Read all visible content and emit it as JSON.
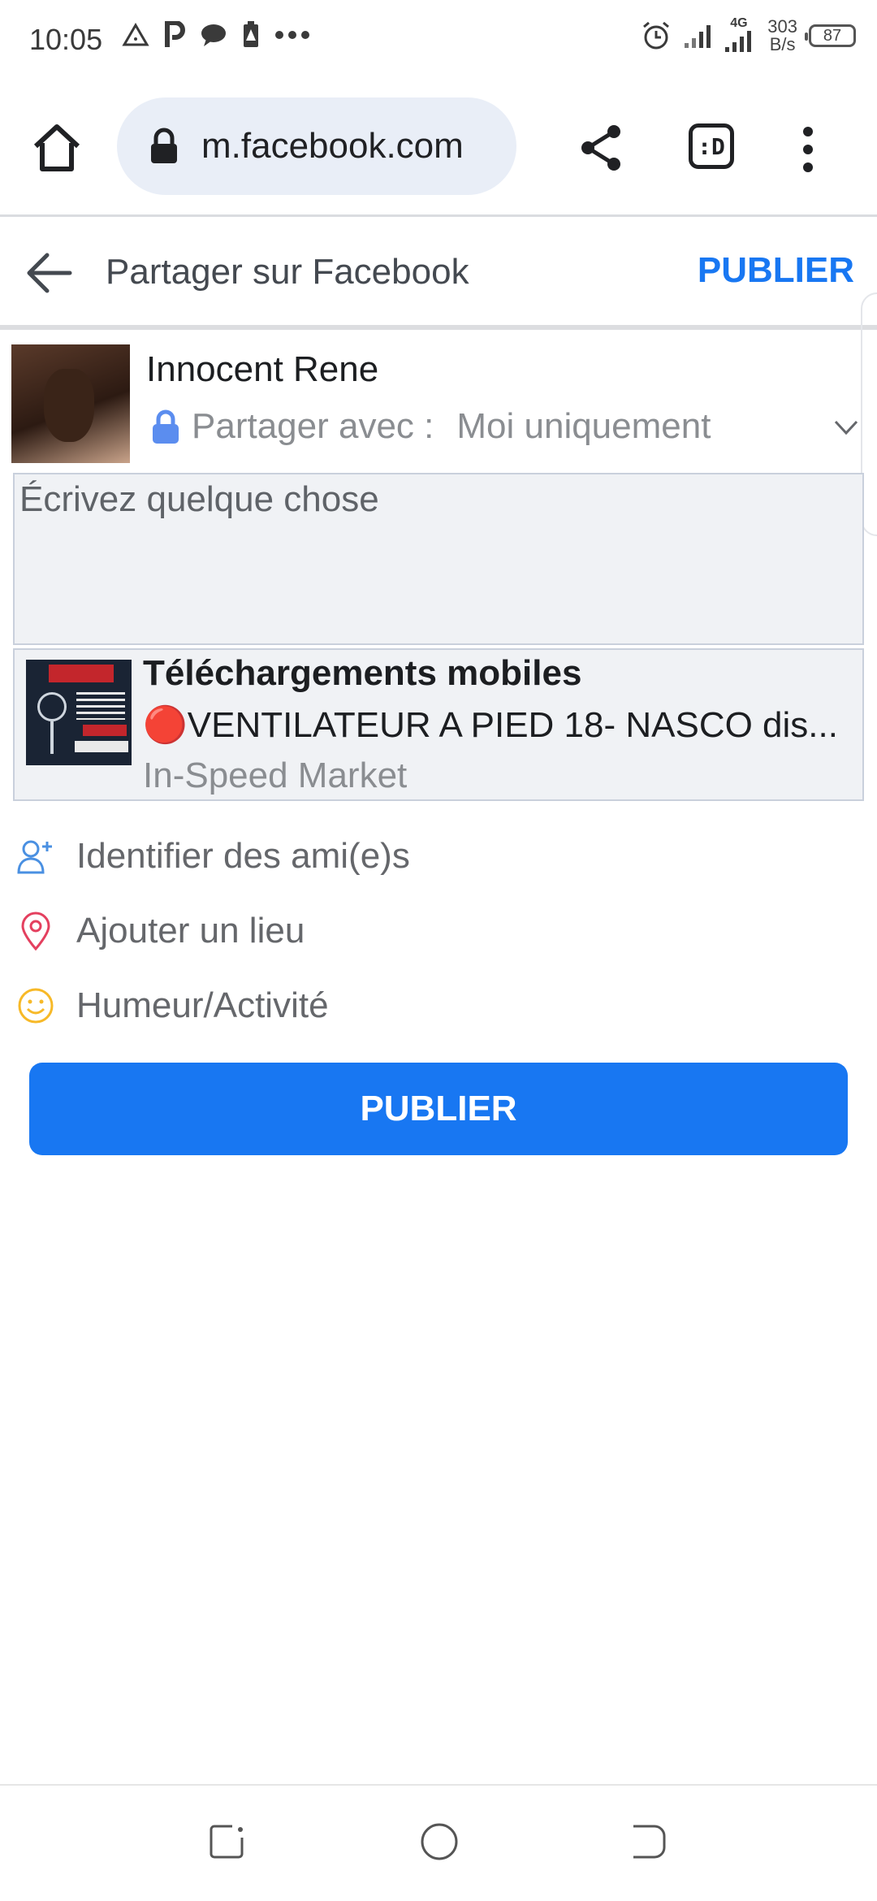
{
  "status_bar": {
    "time": "10:05",
    "network": "4G",
    "speed_value": "303",
    "speed_unit": "B/s",
    "battery": "87",
    "left_icons": [
      "alert-triangle-icon",
      "p-app-icon",
      "chat-bubble-icon",
      "battery-alert-icon",
      "more-dots-icon"
    ],
    "right_icons": [
      "alarm-icon",
      "signal-icon",
      "signal-4g-icon"
    ]
  },
  "browser": {
    "url": "m.facebook.com",
    "tabs_label": ":D"
  },
  "header": {
    "title": "Partager sur Facebook",
    "publish_label": "PUBLIER"
  },
  "composer": {
    "user_name": "Innocent Rene",
    "privacy_label": "Partager avec :",
    "privacy_value": "Moi uniquement",
    "placeholder": "Écrivez quelque chose"
  },
  "link_card": {
    "title": "Téléchargements mobiles",
    "description": "🔴VENTILATEUR A PIED 18- NASCO dis...",
    "source": "In-Speed Market"
  },
  "actions": [
    {
      "label": "Identifier des ami(e)s",
      "icon": "add-friend-icon"
    },
    {
      "label": "Ajouter un lieu",
      "icon": "location-pin-icon"
    },
    {
      "label": "Humeur/Activité",
      "icon": "smiley-icon"
    }
  ],
  "publish_button": "PUBLIER",
  "colors": {
    "accent": "#1877f2",
    "location_icon": "#e4405f",
    "smiley_icon": "#f7b928",
    "friend_icon": "#4a90e2"
  }
}
